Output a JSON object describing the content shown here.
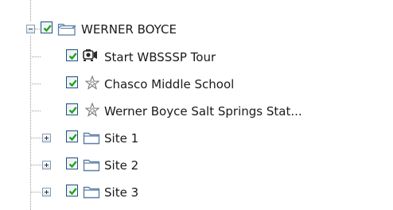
{
  "tree": {
    "root": {
      "label": "WERNER BOYCE",
      "expanded": true,
      "checked": true,
      "icon": "folder-open-icon"
    },
    "children": [
      {
        "label": "Start WBSSSP Tour",
        "checked": true,
        "icon": "tour-icon",
        "expandable": false
      },
      {
        "label": "Chasco Middle School",
        "checked": true,
        "icon": "placemark-icon",
        "expandable": false
      },
      {
        "label": "Werner Boyce Salt Springs Stat...",
        "checked": true,
        "icon": "placemark-icon",
        "expandable": false
      },
      {
        "label": "Site 1",
        "checked": true,
        "icon": "folder-icon",
        "expandable": true,
        "expanded": false
      },
      {
        "label": "Site 2",
        "checked": true,
        "icon": "folder-icon",
        "expandable": true,
        "expanded": false
      },
      {
        "label": "Site 3",
        "checked": true,
        "icon": "folder-icon",
        "expandable": true,
        "expanded": false
      }
    ]
  },
  "colors": {
    "checkmark": "#21a121",
    "checkbox_border": "#1c5180",
    "folder": "#5c7fa5",
    "tree_lines": "#9a9a9a"
  }
}
